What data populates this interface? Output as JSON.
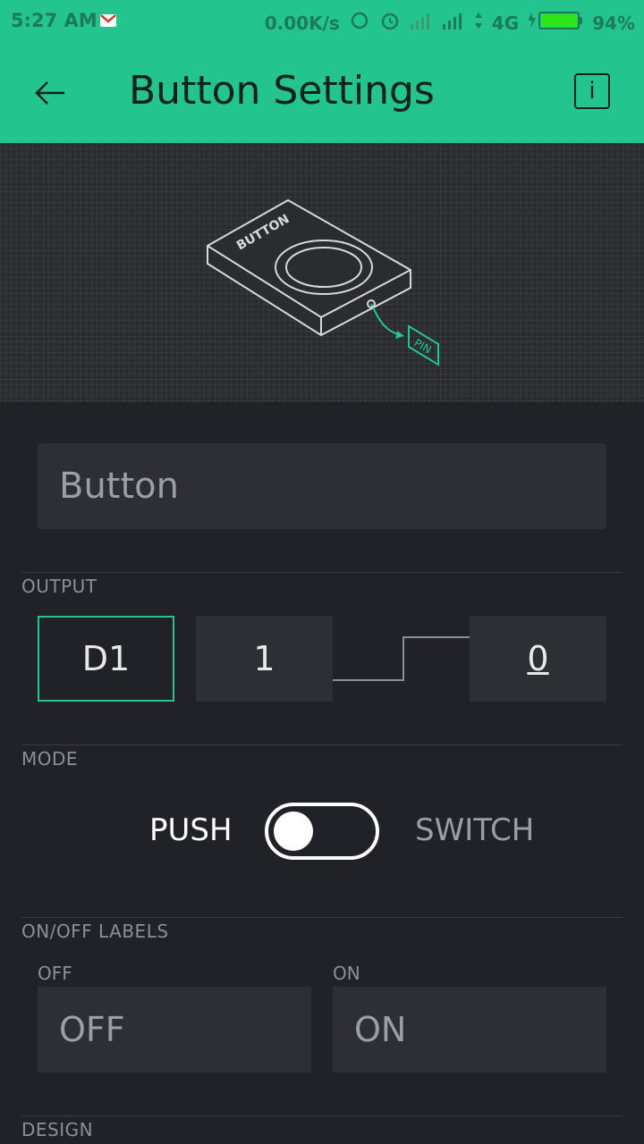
{
  "status_bar": {
    "time": "5:27 AM",
    "speed": "0.00K/s",
    "network": "4G",
    "battery": "94%"
  },
  "app_bar": {
    "title": "Button Settings",
    "info_label": "i"
  },
  "hero": {
    "device_label": "BUTTON",
    "pin_label": "PIN"
  },
  "name_field": {
    "value": "Button"
  },
  "output": {
    "section_label": "OUTPUT",
    "pin": "D1",
    "high_value": "1",
    "low_value": "0"
  },
  "mode": {
    "section_label": "MODE",
    "push_label": "PUSH",
    "switch_label": "SWITCH",
    "selected": "PUSH"
  },
  "labels": {
    "section_label": "ON/OFF LABELS",
    "off_title": "OFF",
    "off_value": "OFF",
    "on_title": "ON",
    "on_value": "ON"
  },
  "design": {
    "section_label": "DESIGN"
  },
  "colors": {
    "accent": "#23c48e",
    "background": "#212227",
    "field": "#2d2f34"
  }
}
